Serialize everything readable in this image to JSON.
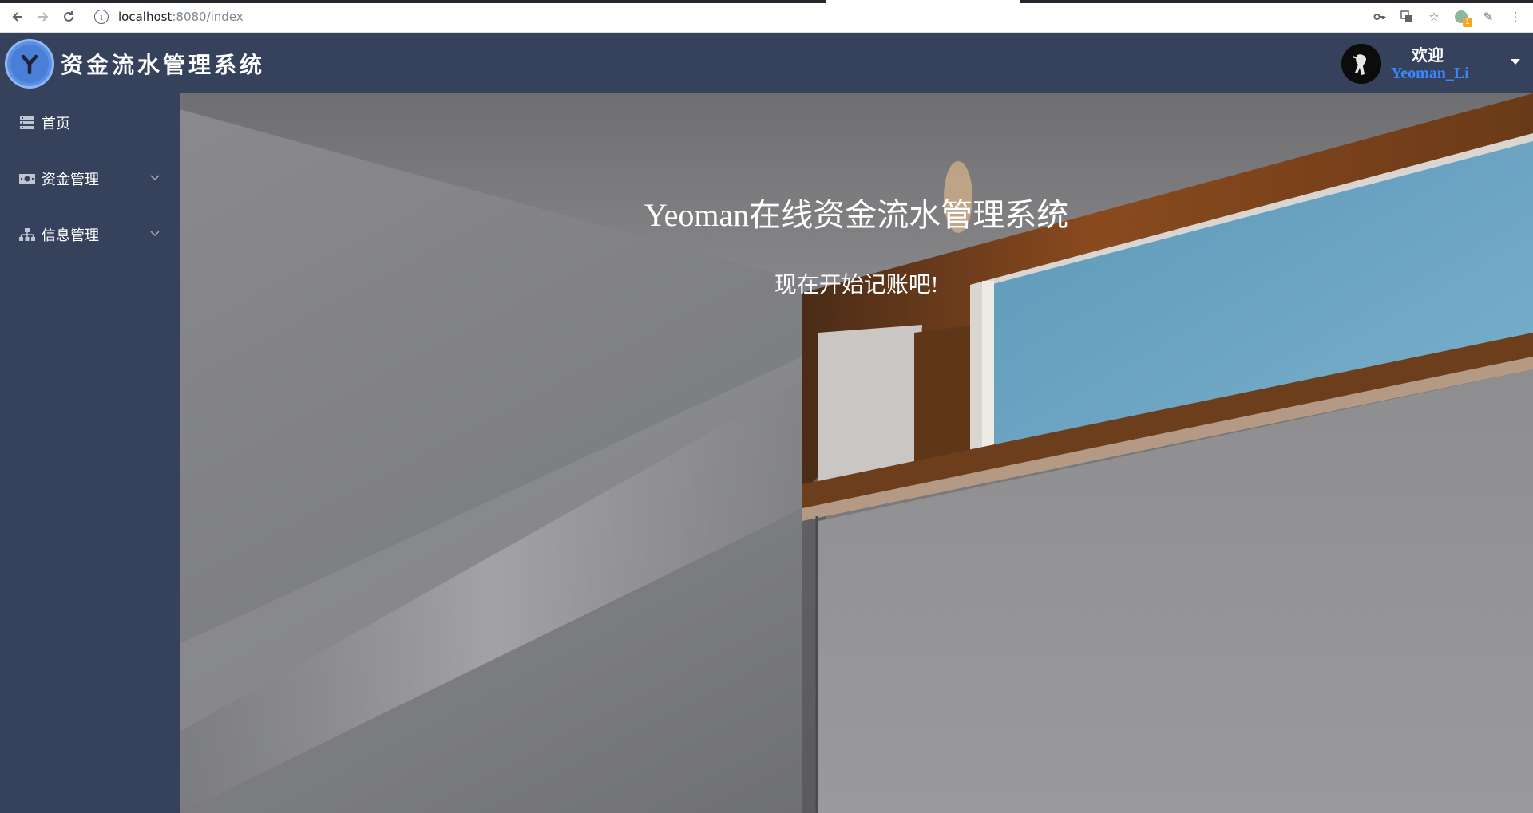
{
  "browser": {
    "url_host": "localhost",
    "url_path": ":8080/index",
    "badge_count": "1"
  },
  "header": {
    "title": "资金流水管理系统",
    "welcome": "欢迎",
    "username": "Yeoman_Li"
  },
  "sidebar": {
    "items": [
      {
        "label": "首页",
        "icon": "server-icon",
        "expandable": false
      },
      {
        "label": "资金管理",
        "icon": "money-icon",
        "expandable": true
      },
      {
        "label": "信息管理",
        "icon": "sitemap-icon",
        "expandable": true
      }
    ]
  },
  "hero": {
    "title": "Yeoman在线资金流水管理系统",
    "subtitle": "现在开始记账吧!"
  },
  "colors": {
    "header_bg": "#36415c",
    "sidebar_bg": "#36415c",
    "username": "#3a86ff",
    "logo": "#5b8fe4"
  }
}
